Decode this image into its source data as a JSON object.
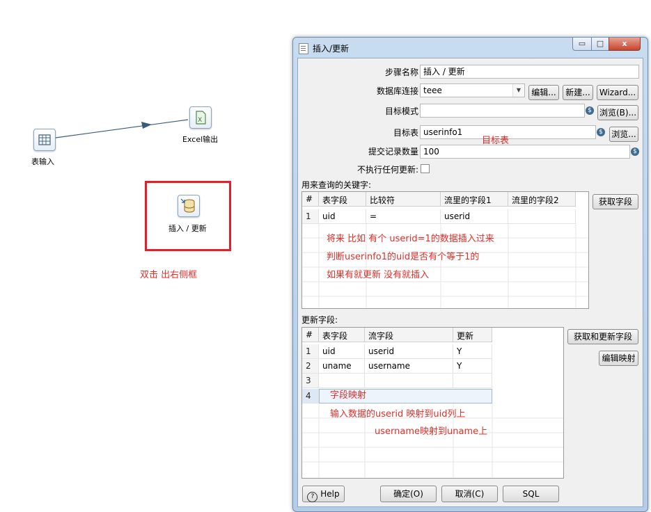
{
  "canvas": {
    "nodes": {
      "table_input": "表输入",
      "excel_output": "Excel输出",
      "insert_update": "插入 / 更新"
    },
    "annotation_double_click": "双击 出右侧框"
  },
  "dialog": {
    "title": "插入/更新",
    "window_buttons": {
      "minimize": "▭",
      "restore": "□",
      "close": "x"
    },
    "fields": {
      "step_name": {
        "label": "步骤名称",
        "value": "插入 / 更新"
      },
      "db_connection": {
        "label": "数据库连接",
        "value": "teee",
        "edit": "编辑...",
        "new": "新建...",
        "wizard": "Wizard..."
      },
      "target_schema": {
        "label": "目标模式",
        "value": "",
        "browse": "浏览(B)..."
      },
      "target_table": {
        "label": "目标表",
        "value": "userinfo1",
        "browse": "浏览...",
        "annotation": "目标表"
      },
      "commit_size": {
        "label": "提交记录数量",
        "value": "100"
      },
      "no_update": {
        "label": "不执行任何更新:"
      }
    },
    "lookup": {
      "section_label": "用来查询的关键字:",
      "get_fields_button": "获取字段",
      "columns": [
        "#",
        "表字段",
        "比较符",
        "流里的字段1",
        "流里的字段2"
      ],
      "rows": [
        {
          "num": "1",
          "table_field": "uid",
          "comparator": "=",
          "stream_field1": "userid",
          "stream_field2": ""
        }
      ],
      "annotations": [
        "将来 比如 有个 userid=1的数据插入过来",
        "判断userinfo1的uid是否有个等于1的",
        "如果有就更新  没有就插入"
      ]
    },
    "update": {
      "section_label": "更新字段:",
      "get_update_button": "获取和更新字段",
      "edit_mapping_button": "编辑映射",
      "columns": [
        "#",
        "表字段",
        "流字段",
        "更新"
      ],
      "rows": [
        {
          "num": "1",
          "table_field": "uid",
          "stream_field": "userid",
          "update": "Y"
        },
        {
          "num": "2",
          "table_field": "uname",
          "stream_field": "username",
          "update": "Y"
        },
        {
          "num": "3",
          "table_field": "",
          "stream_field": "",
          "update": ""
        },
        {
          "num": "4",
          "table_field": "",
          "stream_field": "",
          "update": ""
        }
      ],
      "annotations": [
        "字段映射",
        "输入数据的userid 映射到uid列上",
        "username映射到uname上"
      ]
    },
    "footer": {
      "help": "Help",
      "ok": "确定(O)",
      "cancel": "取消(C)",
      "sql": "SQL"
    }
  },
  "colors": {
    "annotation_red": "#e0302a",
    "highlight_box": "#e0202a",
    "hop_line": "#3a5a7a"
  }
}
